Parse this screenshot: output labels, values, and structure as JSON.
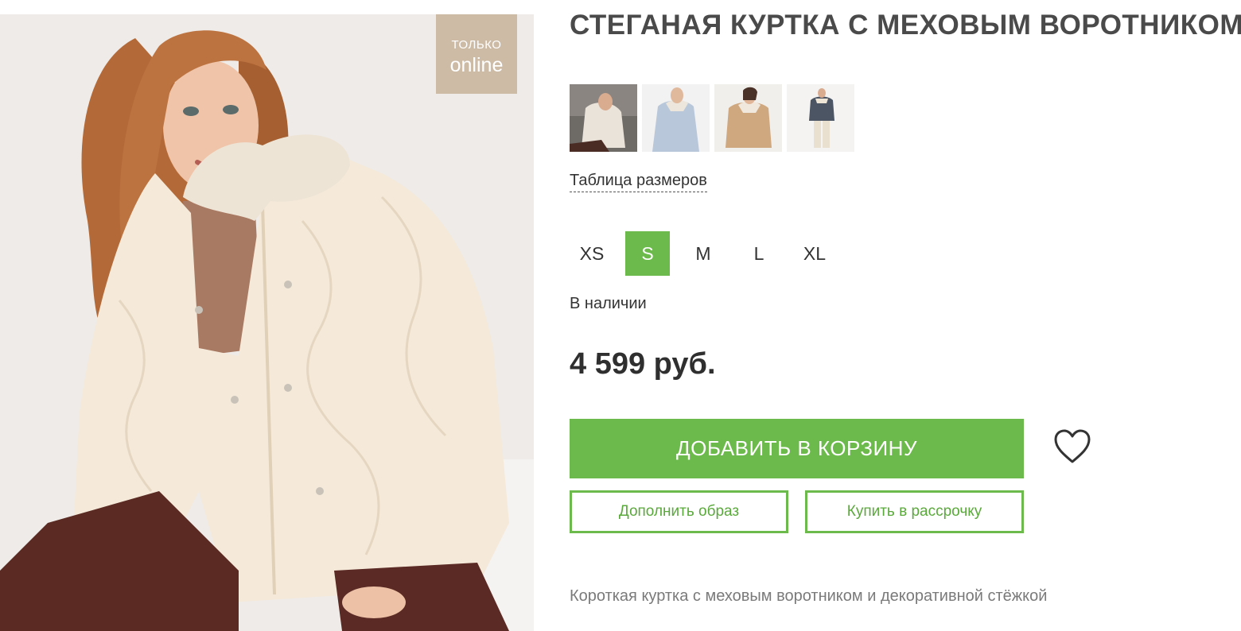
{
  "product": {
    "title": "СТЕГАНАЯ КУРТКА С МЕХОВЫМ ВОРОТНИКОМ",
    "badge": {
      "line1": "ТОЛЬКО",
      "line2": "online"
    },
    "size_table_label": "Таблица размеров",
    "sizes": [
      "XS",
      "S",
      "M",
      "L",
      "XL"
    ],
    "selected_size": "S",
    "availability": "В наличии",
    "price": "4 599 руб.",
    "description": "Короткая куртка с меховым воротником и декоративной стёжкой"
  },
  "actions": {
    "add_to_cart": "ДОБАВИТЬ В КОРЗИНУ",
    "complete_look": "Дополнить образ",
    "installment": "Купить в рассрочку"
  },
  "colors": {
    "accent": "#6dba4c",
    "badge": "#cdbba6",
    "jacket": "#f3e8d6",
    "hair": "#b66d3a",
    "trousers": "#5b2a24"
  },
  "icons": {
    "favorite": "heart-icon"
  }
}
